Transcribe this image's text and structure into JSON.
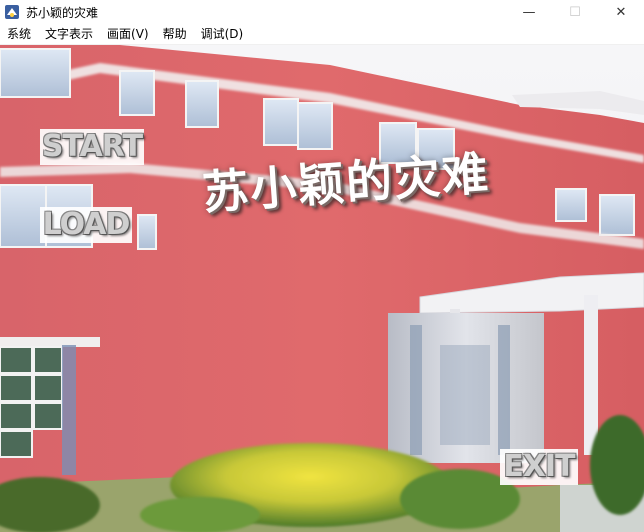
{
  "window": {
    "title": "苏小颖的灾难",
    "controls": {
      "minimize": "—",
      "maximize": "☐",
      "close": "✕"
    }
  },
  "menubar": {
    "items": [
      {
        "label": "系统"
      },
      {
        "label": "文字表示"
      },
      {
        "label": "画面(V)"
      },
      {
        "label": "帮助"
      },
      {
        "label": "调试(D)"
      }
    ]
  },
  "game": {
    "title": "苏小颖的灾难",
    "buttons": {
      "start": "START",
      "load": "LOAD",
      "exit": "EXIT"
    },
    "colors": {
      "building": "#e06c6c",
      "building_dark": "#c85a5c",
      "window_glass": "#c8d8ec",
      "trim": "#f4f0f0",
      "foliage": "#5a7a2c",
      "foliage_yellow": "#e8dc3a"
    }
  }
}
